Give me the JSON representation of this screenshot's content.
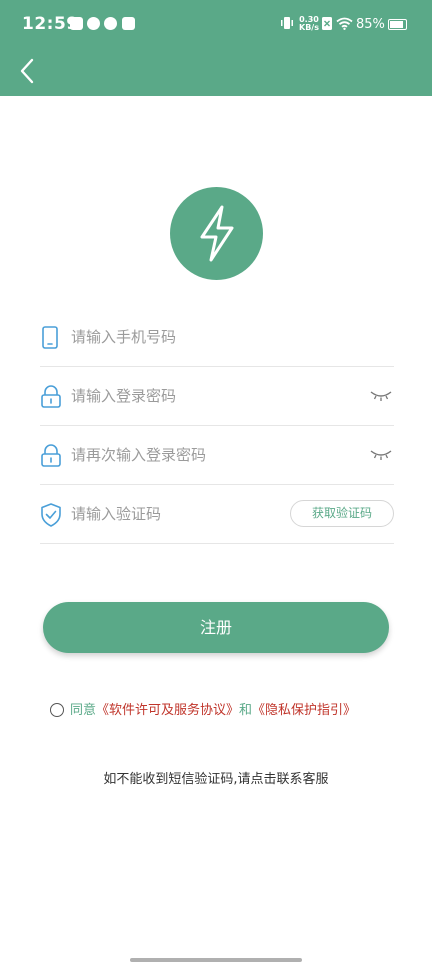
{
  "status_bar": {
    "time": "12:59",
    "net_speed_value": "0.30",
    "net_speed_unit": "KB/s",
    "battery": "85%",
    "battery_level": 0.85
  },
  "header": {
    "back_icon": "chevron-left-icon"
  },
  "logo": {
    "icon": "lightning-bolt-icon"
  },
  "form": {
    "phone": {
      "placeholder": "请输入手机号码",
      "value": "",
      "icon": "phone-icon"
    },
    "password": {
      "placeholder": "请输入登录密码",
      "value": "",
      "icon": "lock-icon",
      "toggle_icon": "eye-closed-icon"
    },
    "confirm_password": {
      "placeholder": "请再次输入登录密码",
      "value": "",
      "icon": "lock-icon",
      "toggle_icon": "eye-closed-icon"
    },
    "code": {
      "placeholder": "请输入验证码",
      "value": "",
      "icon": "shield-check-icon",
      "button_label": "获取验证码"
    }
  },
  "register_button": {
    "label": "注册"
  },
  "agreement": {
    "prefix": "同意",
    "terms_link": "《软件许可及服务协议》",
    "connector": "和",
    "privacy_link": "《隐私保护指引》"
  },
  "help_text": "如不能收到短信验证码,请点击联系客服",
  "colors": {
    "primary": "#5aa988",
    "link_red": "#c0352b",
    "icon_blue": "#4a9fd8"
  }
}
